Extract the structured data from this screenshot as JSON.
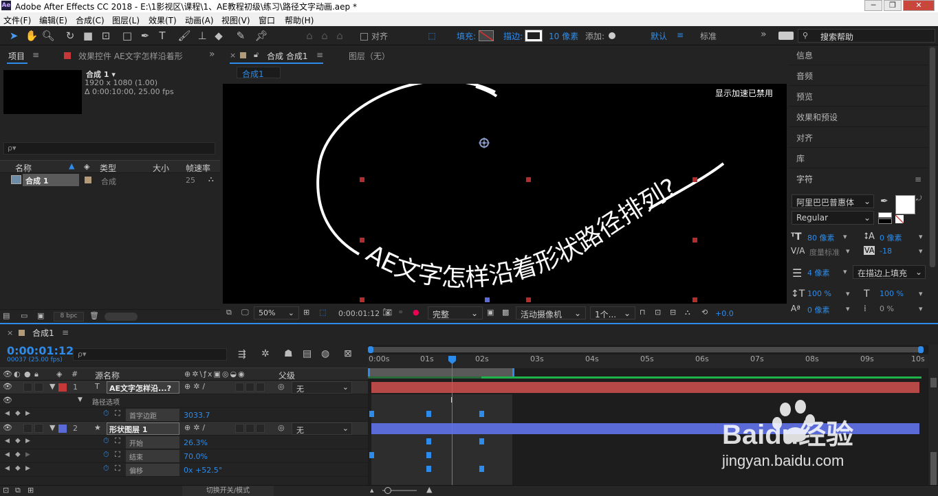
{
  "window": {
    "title": "Adobe After Effects CC 2018 - E:\\1影视区\\课程\\1、AE教程初级\\练习\\路径文字动画.aep *",
    "logo": "Ae",
    "minimize": "─",
    "restore": "❐",
    "close": "✕"
  },
  "menu": [
    "文件(F)",
    "编辑(E)",
    "合成(C)",
    "图层(L)",
    "效果(T)",
    "动画(A)",
    "视图(V)",
    "窗口",
    "帮助(H)"
  ],
  "toolbar": {
    "align_label": "对齐",
    "fill_label": "填充:",
    "stroke_label": "描边:",
    "stroke_width": "10 像素",
    "add_label": "添加:",
    "workspace_default": "默认",
    "workspace_standard": "标准",
    "overflow": "»",
    "search_help": "搜索帮助"
  },
  "project_panel": {
    "tab_project": "项目",
    "tab_effects": "效果控件 AE文字怎样沿着形",
    "comp_name": "合成 1 ▾",
    "comp_size": "1920 x 1080 (1.00)",
    "comp_duration": "Δ 0:00:10:00, 25.00 fps",
    "search_icon_label": "ρ▾",
    "columns": [
      "名称",
      "类型",
      "大小",
      "帧速率"
    ],
    "rows": [
      {
        "name": "合成 1",
        "type": "合成",
        "size": "",
        "fps": "25"
      }
    ],
    "bpc": "8 bpc"
  },
  "comp_panel": {
    "tab_comp": "合成 合成1",
    "tab_layer": "图层（无）",
    "sub_tab": "合成1",
    "gpu_notice": "显示加速已禁用",
    "path_text": "AE文字怎样沿着形状路径排列?",
    "zoom": "50%",
    "timecode": "0:00:01:12",
    "resolution": "完整",
    "camera": "活动摄像机",
    "views": "1个...",
    "exposure": "+0.0"
  },
  "right_panel": {
    "items": [
      "信息",
      "音频",
      "预览",
      "效果和预设",
      "对齐",
      "库"
    ],
    "character_title": "字符",
    "font_family": "阿里巴巴普惠体",
    "font_style": "Regular",
    "font_size": "80 像素",
    "leading": "0 像素",
    "kerning_label": "度量标准",
    "tracking": "-18",
    "stroke_width": "4 像素",
    "stroke_mode": "在描边上填充",
    "vscale": "100 %",
    "hscale": "100 %",
    "baseline": "0 像素",
    "tsume": "0 %"
  },
  "timeline": {
    "tab": "合成1",
    "current_time": "0:00:01:12",
    "frames": "00037 (25.00 fps)",
    "search_label": "ρ▾",
    "col_source": "源名称",
    "col_parent": "父级",
    "ruler": [
      "0:00s",
      "01s",
      "02s",
      "03s",
      "04s",
      "05s",
      "06s",
      "07s",
      "08s",
      "09s",
      "10s"
    ],
    "layers": [
      {
        "num": "1",
        "type_icon": "T",
        "name": "AE文字怎样沿...?",
        "parent": "无"
      },
      {
        "num": "2",
        "type_icon": "★",
        "name": "形状图层 1",
        "parent": "无"
      }
    ],
    "path_options": "路径选项",
    "props": [
      {
        "name": "首字边距",
        "value": "3033.7"
      },
      {
        "name": "开始",
        "value": "26.3%"
      },
      {
        "name": "结束",
        "value": "70.0%"
      },
      {
        "name": "偏移",
        "value": "0x +52.5°"
      }
    ],
    "footer_toggle": "切换开关/模式"
  },
  "watermark": {
    "brand": "Baidu经验",
    "url": "jingyan.baidu.com"
  },
  "colors": {
    "accent": "#2d8ceb",
    "layer1": "#c63838",
    "layer2": "#5a6bd8",
    "work_area": "#1fb34c"
  }
}
